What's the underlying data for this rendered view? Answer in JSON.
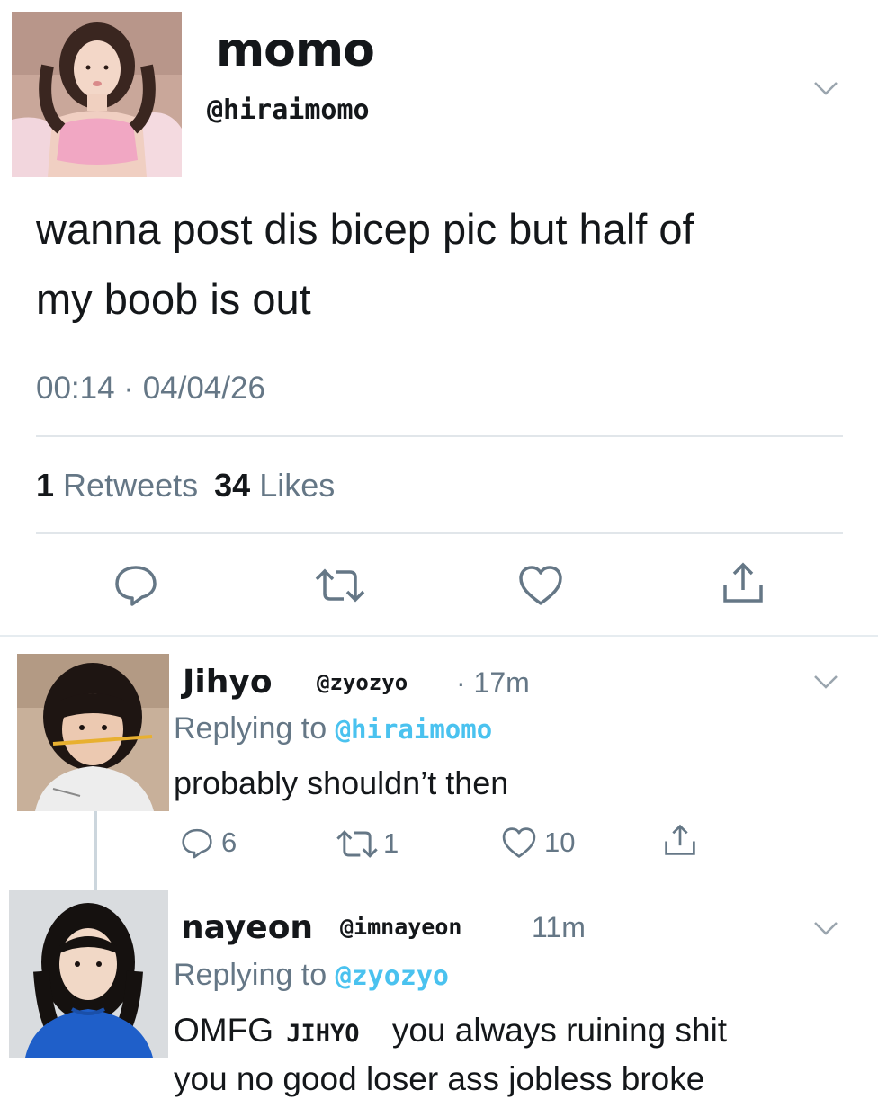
{
  "tweet": {
    "display_name": "momo",
    "handle": "@hiraimomo",
    "text_line1": "wanna post dis bicep pic but half of",
    "text_line2": "my boob is out",
    "timestamp": "00:14 · 04/04/26",
    "retweets_count": "1",
    "retweets_label": "Retweets",
    "likes_count": "34",
    "likes_label": "Likes"
  },
  "replies": [
    {
      "display_name": "Jihyo",
      "handle": "@zyozyo",
      "time": "· 17m",
      "replying_prefix": "Replying to",
      "replying_handle": "@hiraimomo",
      "text": "probably shouldn’t then",
      "reply_count": "6",
      "retweet_count": "1",
      "like_count": "10"
    },
    {
      "display_name": "nayeon",
      "handle": "@imnayeon",
      "time": "11m",
      "replying_prefix": "Replying to",
      "replying_handle": "@zyozyo",
      "text_part1": "OMFG",
      "text_name": "JIHYO",
      "text_part2": "you always ruining shit",
      "text_line2": "you no good loser ass jobless broke"
    }
  ],
  "icons": [
    "chevron-down-icon",
    "reply-icon",
    "retweet-icon",
    "heart-icon",
    "share-icon"
  ],
  "colors": {
    "link": "#4ac2ef",
    "muted": "#657786",
    "text": "#14171a",
    "divider": "#e1e6ea"
  }
}
